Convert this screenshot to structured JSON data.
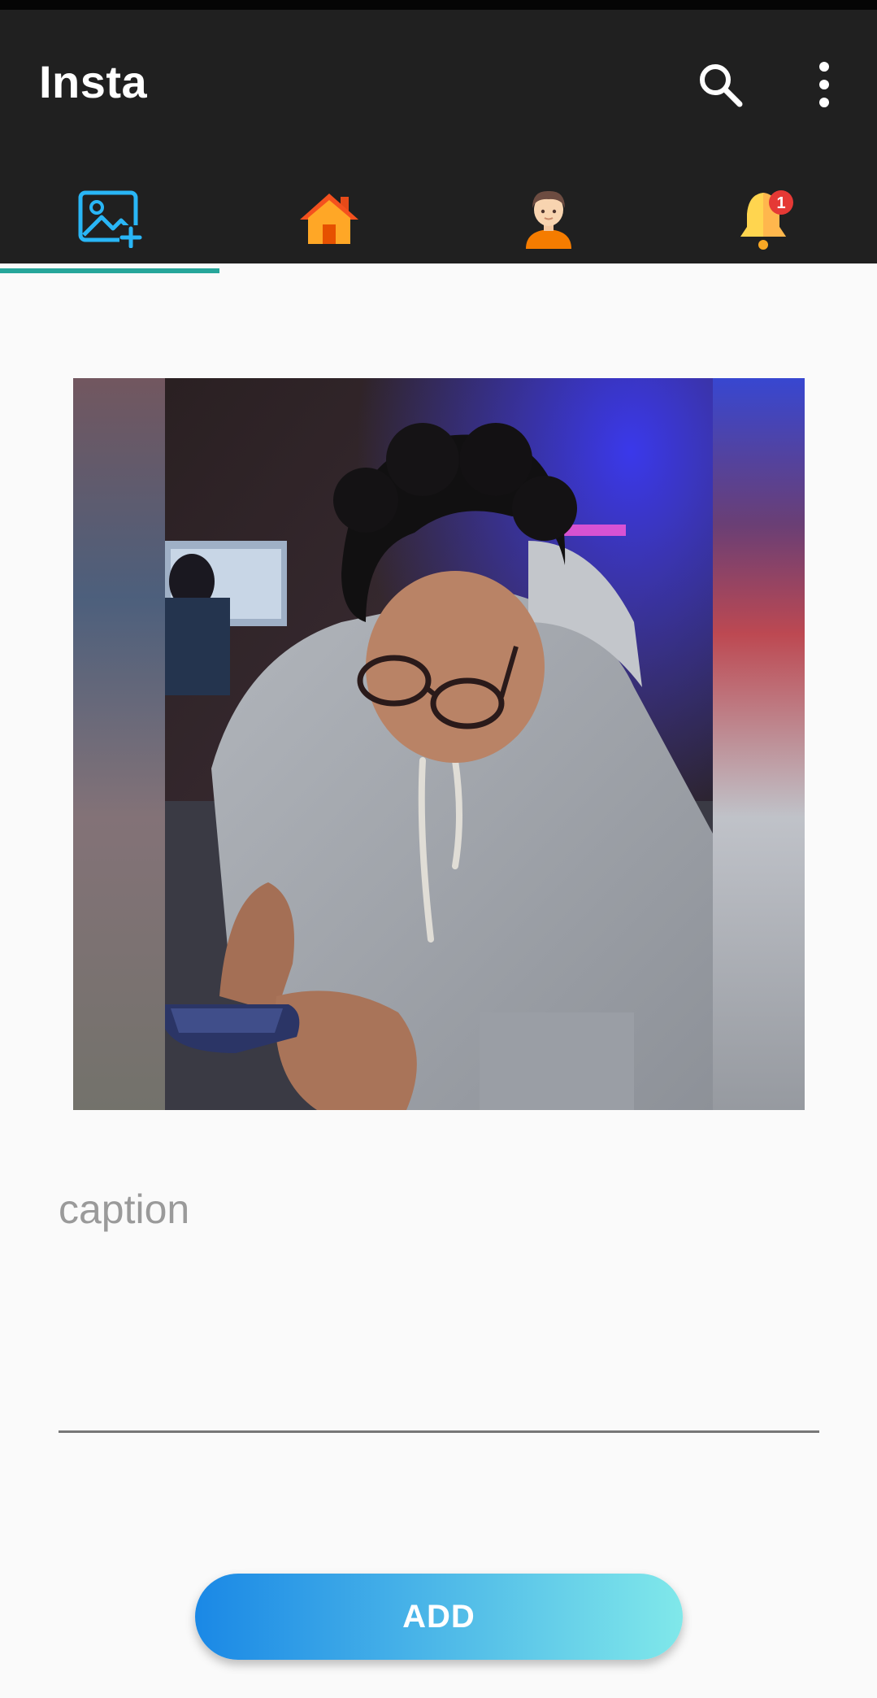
{
  "app_bar": {
    "title": "Insta",
    "background": "#202020",
    "actions": [
      {
        "name": "search",
        "icon": "search-icon"
      },
      {
        "name": "more-options",
        "icon": "more-vertical-icon"
      }
    ]
  },
  "tabs": {
    "selected_index": 0,
    "indicator_color": "#26a69a",
    "items": [
      {
        "name": "add-post",
        "icon": "add-photo-icon"
      },
      {
        "name": "home",
        "icon": "home-icon"
      },
      {
        "name": "profile",
        "icon": "profile-avatar-icon"
      },
      {
        "name": "notifications",
        "icon": "bell-icon",
        "badge": "1"
      }
    ]
  },
  "photo": {
    "description": "selected-photo-preview"
  },
  "caption": {
    "placeholder": "caption",
    "value": ""
  },
  "add_button": {
    "label": "ADD",
    "gradient_start": "#1a88e6",
    "gradient_end": "#80e8ea"
  }
}
